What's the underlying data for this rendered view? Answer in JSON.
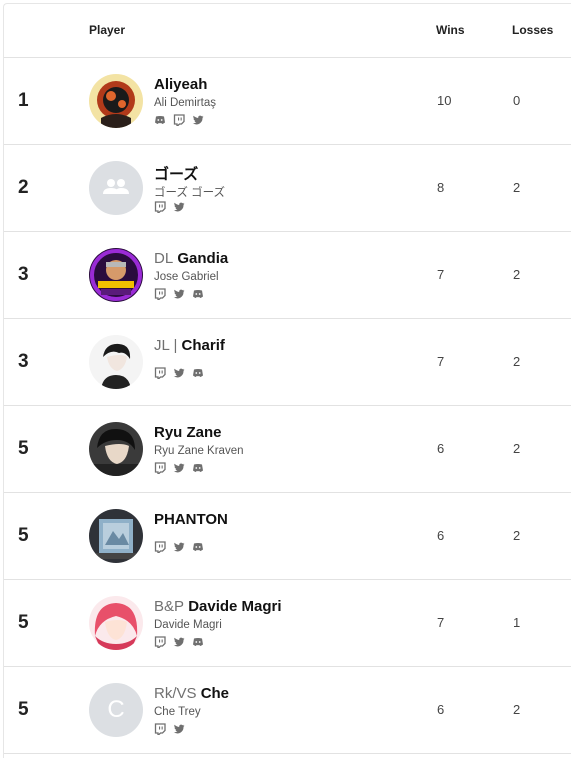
{
  "columns": {
    "player": "Player",
    "wins": "Wins",
    "losses": "Losses"
  },
  "rows": [
    {
      "rank": "1",
      "team": "",
      "name": "Aliyeah",
      "sub": "Ali Demirtaş",
      "wins": "10",
      "losses": "0",
      "socials": [
        "discord-icon",
        "twitch-icon",
        "twitter-icon"
      ]
    },
    {
      "rank": "2",
      "team": "",
      "name": "ゴーズ",
      "sub": "ゴーズ ゴーズ",
      "wins": "8",
      "losses": "2",
      "socials": [
        "twitch-icon",
        "twitter-icon"
      ]
    },
    {
      "rank": "3",
      "team": "DL",
      "name": "Gandia",
      "sub": "Jose Gabriel",
      "wins": "7",
      "losses": "2",
      "socials": [
        "twitch-icon",
        "twitter-icon",
        "discord-icon"
      ]
    },
    {
      "rank": "3",
      "team": "JL |",
      "name": "Charif",
      "sub": "",
      "wins": "7",
      "losses": "2",
      "socials": [
        "twitch-icon",
        "twitter-icon",
        "discord-icon"
      ]
    },
    {
      "rank": "5",
      "team": "",
      "name": "Ryu Zane",
      "sub": "Ryu Zane Kraven",
      "wins": "6",
      "losses": "2",
      "socials": [
        "twitch-icon",
        "twitter-icon",
        "discord-icon"
      ]
    },
    {
      "rank": "5",
      "team": "",
      "name": "PHANTON",
      "sub": "",
      "wins": "6",
      "losses": "2",
      "socials": [
        "twitch-icon",
        "twitter-icon",
        "discord-icon"
      ]
    },
    {
      "rank": "5",
      "team": "B&P",
      "name": "Davide Magri",
      "sub": "Davide Magri",
      "wins": "7",
      "losses": "1",
      "socials": [
        "twitch-icon",
        "twitter-icon",
        "discord-icon"
      ]
    },
    {
      "rank": "5",
      "team": "Rk/VS",
      "name": "Che",
      "sub": "Che Trey",
      "wins": "6",
      "losses": "2",
      "socials": [
        "twitch-icon",
        "twitter-icon"
      ]
    }
  ],
  "placeholder_avatar_letter": "C",
  "colors": {
    "icon_gray": "#6f6f6f",
    "placeholder_bg": "#dcdfe3"
  }
}
